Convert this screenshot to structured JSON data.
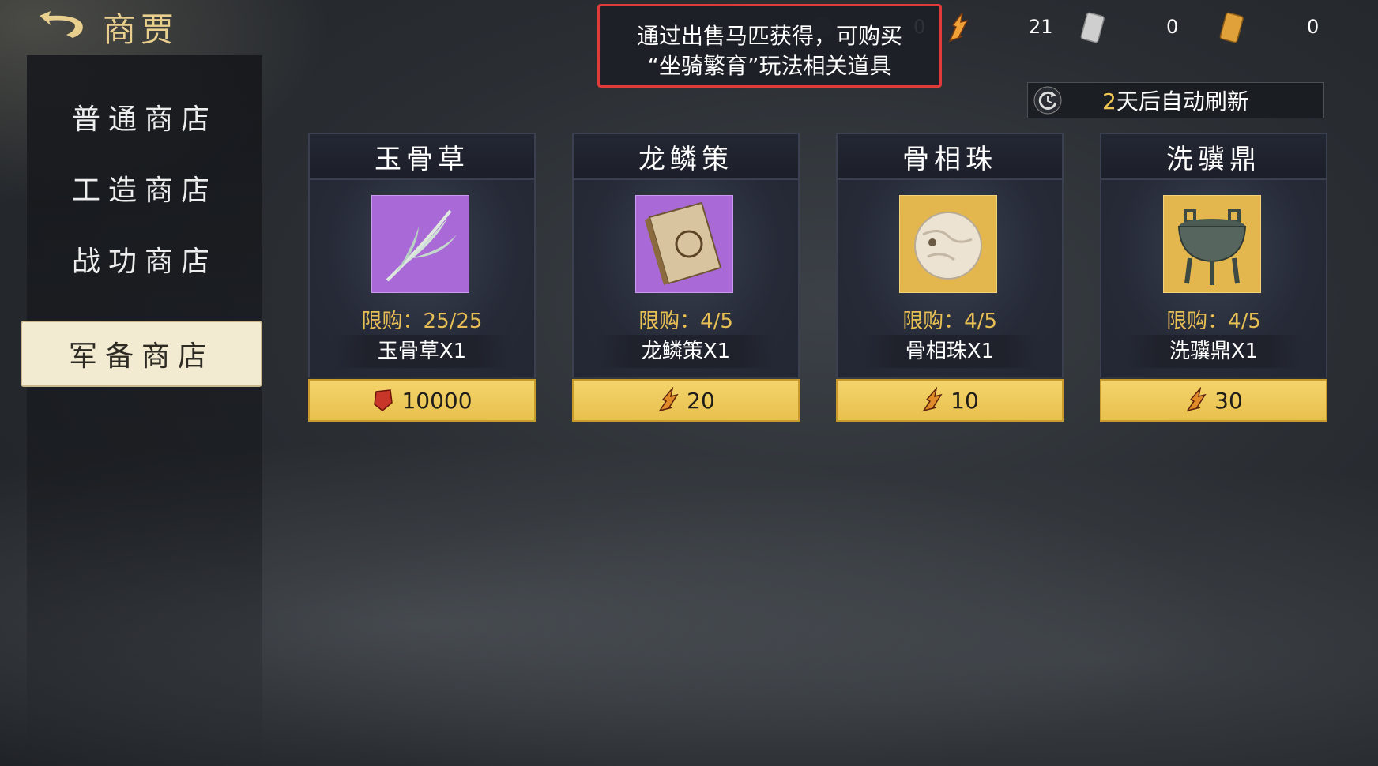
{
  "header": {
    "title": "商贾"
  },
  "currencies": [
    {
      "icon": "horse-token-icon",
      "value": "0"
    },
    {
      "icon": "flame-token-icon",
      "value": "21"
    },
    {
      "icon": "silver-coin-icon",
      "value": "0"
    },
    {
      "icon": "gold-coin-icon",
      "value": "0"
    }
  ],
  "tooltip": {
    "line1": "通过出售马匹获得，可购买",
    "line2": "“坐骑繁育”玩法相关道具"
  },
  "refresh": {
    "days": "2",
    "suffix": "天后自动刷新"
  },
  "sidebar": {
    "items": [
      {
        "label": "普通商店"
      },
      {
        "label": "工造商店"
      },
      {
        "label": "战功商店"
      },
      {
        "label": "军备商店",
        "active": true
      }
    ]
  },
  "items": [
    {
      "title": "玉骨草",
      "limit": "限购：25/25",
      "name": "玉骨草X1",
      "price": "10000",
      "price_icon": "red-token-icon",
      "icon": "grass-icon"
    },
    {
      "title": "龙鳞策",
      "limit": "限购：4/5",
      "name": "龙鳞策X1",
      "price": "20",
      "price_icon": "flame-token-icon",
      "icon": "book-icon"
    },
    {
      "title": "骨相珠",
      "limit": "限购：4/5",
      "name": "骨相珠X1",
      "price": "10",
      "price_icon": "flame-token-icon",
      "icon": "pearl-icon"
    },
    {
      "title": "洗骥鼎",
      "limit": "限购：4/5",
      "name": "洗骥鼎X1",
      "price": "30",
      "price_icon": "flame-token-icon",
      "icon": "cauldron-icon"
    }
  ],
  "colors": {
    "gold": "#e7bf55",
    "accent_bar": "#f4d46b",
    "tooltip_border": "#e23a3a"
  }
}
